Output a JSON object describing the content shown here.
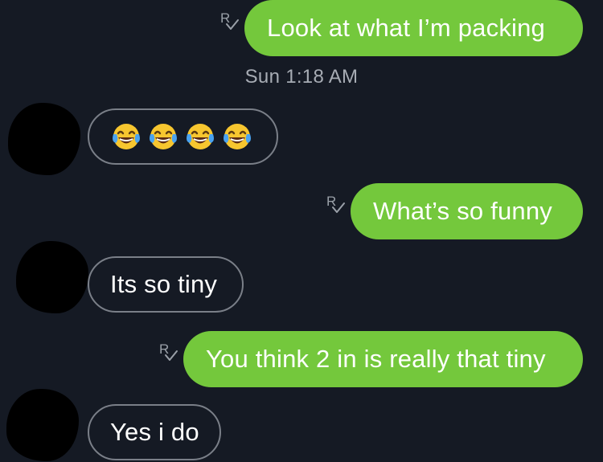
{
  "messages": [
    {
      "id": "m1",
      "direction": "outgoing",
      "text": "Look at what I’m packing",
      "read_receipt": "read-receipt-icon"
    },
    {
      "id": "m2",
      "direction": "incoming",
      "text": "😂😂😂😂",
      "emoji": "face-with-tears-of-joy",
      "emoji_count": 4
    },
    {
      "id": "m3",
      "direction": "outgoing",
      "text": "What’s so funny",
      "read_receipt": "read-receipt-icon"
    },
    {
      "id": "m4",
      "direction": "incoming",
      "text": "Its so tiny"
    },
    {
      "id": "m5",
      "direction": "outgoing",
      "text": "You think 2 in is really that tiny",
      "read_receipt": "read-receipt-icon"
    },
    {
      "id": "m6",
      "direction": "incoming",
      "text": "Yes i do"
    }
  ],
  "timestamp": "Sun 1:18 AM",
  "colors": {
    "background": "#151a24",
    "outgoing_bubble": "#74c83c",
    "incoming_border": "#7a7f88",
    "text": "#ffffff",
    "timestamp": "#a7acb4",
    "receipt_icon": "#9aa0a8",
    "avatar": "#000000"
  },
  "icons": {
    "read_receipt": "read-receipt-icon",
    "avatar": "avatar-redacted"
  }
}
